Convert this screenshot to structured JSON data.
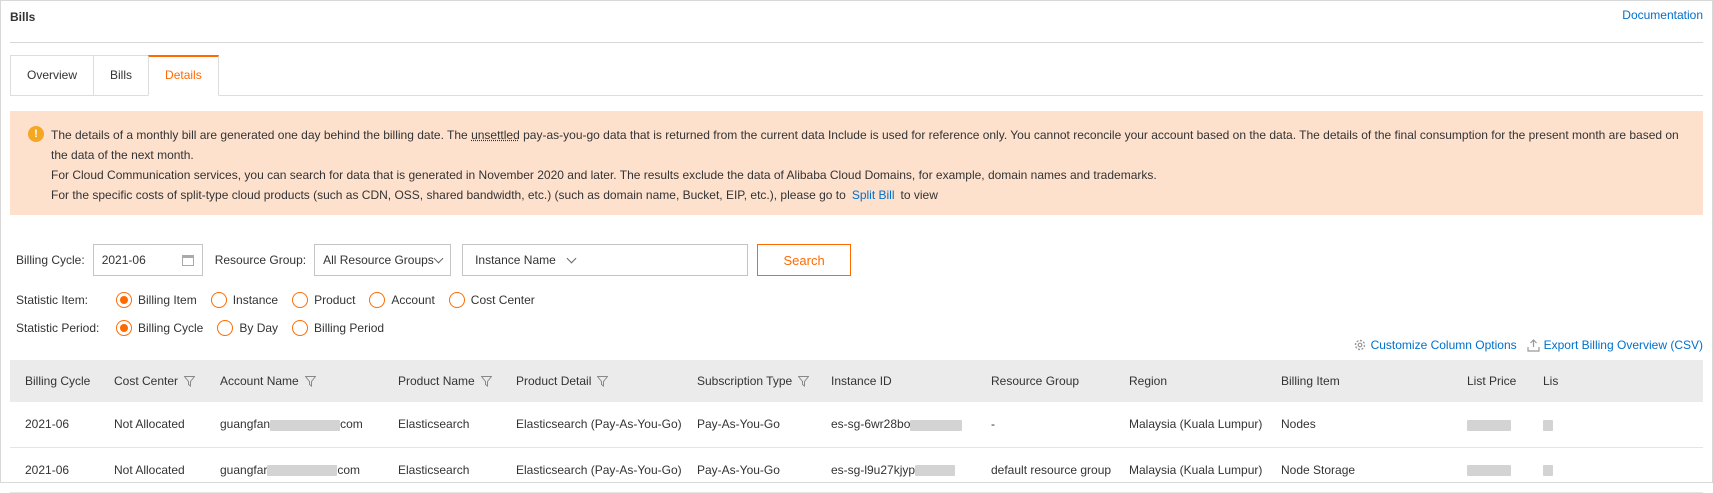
{
  "header": {
    "title": "Bills",
    "doc_link": "Documentation"
  },
  "tabs": [
    {
      "label": "Overview",
      "active": false
    },
    {
      "label": "Bills",
      "active": false
    },
    {
      "label": "Details",
      "active": true
    }
  ],
  "notice": {
    "line1_pre": "The details of a monthly bill are generated one day behind the billing date. The",
    "line1_underlined": "unsettled",
    "line1_post": "pay-as-you-go data that is returned from the current data Include is used for reference only. You cannot reconcile your account based on the data. The details of the final consumption for the present month are based on the data of the next month.",
    "line2": "For Cloud Communication services, you can search for data that is generated in November 2020 and later. The results exclude the data of Alibaba Cloud Domains, for example, domain names and trademarks.",
    "line3_pre": "For the specific costs of split-type cloud products (such as CDN, OSS, shared bandwidth, etc.) (such as domain name, Bucket, EIP, etc.), please go to",
    "line3_link": "Split Bill",
    "line3_post": "to view"
  },
  "filters": {
    "billing_cycle_label": "Billing Cycle:",
    "billing_cycle_value": "2021-06",
    "resource_group_label": "Resource Group:",
    "resource_group_value": "All Resource Groups",
    "instance_select": "Instance Name",
    "search_button": "Search"
  },
  "statistic_item": {
    "label": "Statistic Item:",
    "options": [
      "Billing Item",
      "Instance",
      "Product",
      "Account",
      "Cost Center"
    ],
    "selected": "Billing Item"
  },
  "statistic_period": {
    "label": "Statistic Period:",
    "options": [
      "Billing Cycle",
      "By Day",
      "Billing Period"
    ],
    "selected": "Billing Cycle"
  },
  "actions": {
    "customize": "Customize Column Options",
    "export": "Export Billing Overview (CSV)"
  },
  "table": {
    "columns": [
      "Billing Cycle",
      "Cost Center",
      "Account Name",
      "Product Name",
      "Product Detail",
      "Subscription Type",
      "Instance ID",
      "Resource Group",
      "Region",
      "Billing Item",
      "List Price",
      "Lis"
    ],
    "rows": [
      [
        "2021-06",
        "Not Allocated",
        "guangfan",
        "com",
        "Elasticsearch",
        "Elasticsearch (Pay-As-You-Go)",
        "Pay-As-You-Go",
        "es-sg-6wr28bo",
        "-",
        "Malaysia (Kuala Lumpur)",
        "Nodes"
      ],
      [
        "2021-06",
        "Not Allocated",
        "guangfar",
        "com",
        "Elasticsearch",
        "Elasticsearch (Pay-As-You-Go)",
        "Pay-As-You-Go",
        "es-sg-l9u27kjyp",
        "default resource group",
        "Malaysia (Kuala Lumpur)",
        "Node Storage"
      ]
    ]
  },
  "colors": {
    "accent": "#ff6a00",
    "link": "#0070cc",
    "notice_bg": "#fde1cd"
  }
}
